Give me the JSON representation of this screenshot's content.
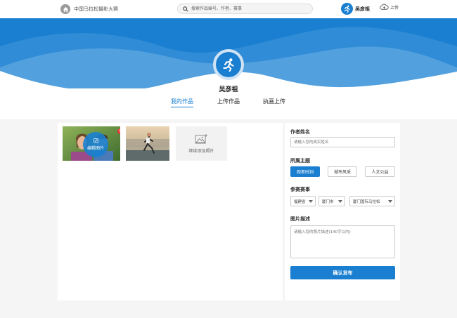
{
  "header": {
    "site_title": "中国马拉松摄影大赛",
    "search_placeholder": "搜索作品编号、作者、赛事",
    "user_name": "吴彦祖",
    "upload_label": "上传"
  },
  "profile": {
    "name": "吴彦祖",
    "tabs": [
      {
        "label": "我的作品",
        "active": true
      },
      {
        "label": "上传作品",
        "active": false
      },
      {
        "label": "执画上传",
        "active": false
      }
    ]
  },
  "photos": {
    "edit_label": "编辑图片",
    "delete_label": "×",
    "add_label": "继续添加照片"
  },
  "form": {
    "author_label": "作者姓名",
    "author_placeholder": "请输入您的真实姓名",
    "theme_label": "所属主题",
    "themes": [
      {
        "label": "跑者时刻",
        "selected": true
      },
      {
        "label": "城市风采",
        "selected": false
      },
      {
        "label": "人文公益",
        "selected": false
      }
    ],
    "event_label": "参赛赛事",
    "province": "福建省",
    "city": "厦门市",
    "event": "厦门国际马拉松",
    "desc_label": "图片描述",
    "desc_placeholder": "请输入您的照片描述(140字以内)",
    "submit_label": "确认发布"
  },
  "colors": {
    "accent": "#1a7fd0",
    "banner_dark": "#1a7fd0",
    "banner_light": "#5aa6e0"
  }
}
